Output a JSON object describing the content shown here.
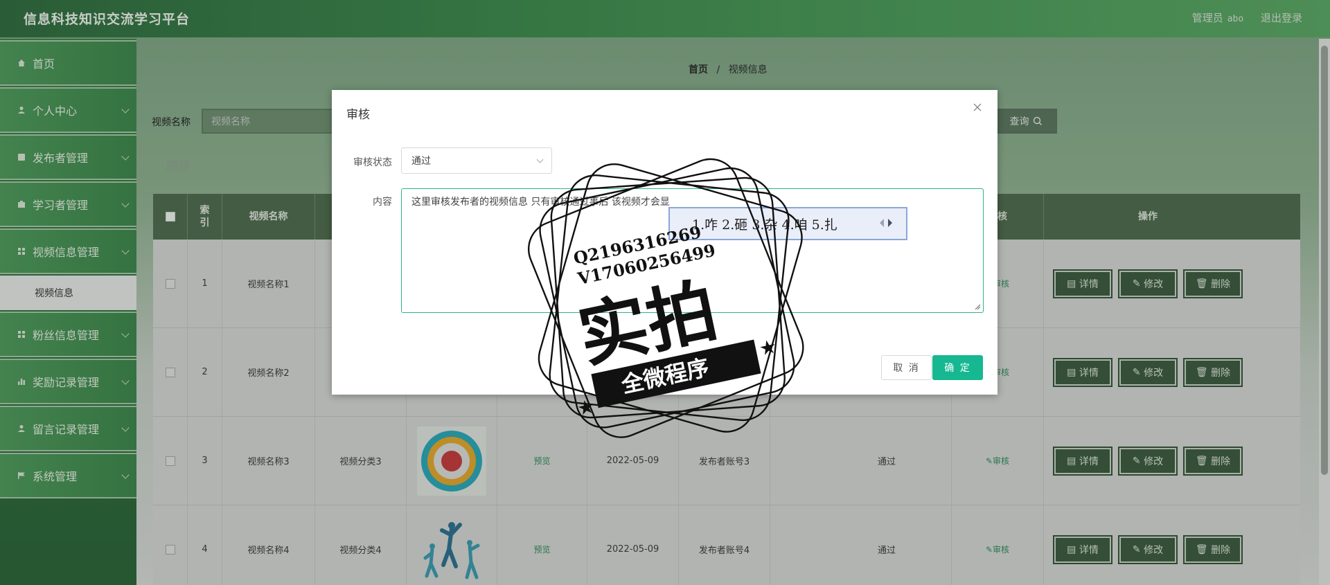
{
  "header": {
    "app_title": "信息科技知识交流学习平台",
    "role": "管理员",
    "username": "abo",
    "logout": "退出登录"
  },
  "sidebar": {
    "items": [
      {
        "label": "首页",
        "icon": "home-icon"
      },
      {
        "label": "个人中心",
        "icon": "person-icon"
      },
      {
        "label": "发布者管理",
        "icon": "book-icon"
      },
      {
        "label": "学习者管理",
        "icon": "briefcase-icon"
      },
      {
        "label": "视频信息管理",
        "icon": "grid-icon"
      },
      {
        "label": "视频信息",
        "icon": ""
      },
      {
        "label": "粉丝信息管理",
        "icon": "grid-icon"
      },
      {
        "label": "奖励记录管理",
        "icon": "bar-chart-icon"
      },
      {
        "label": "留言记录管理",
        "icon": "person-icon"
      },
      {
        "label": "系统管理",
        "icon": "flag-icon"
      }
    ]
  },
  "breadcrumb": {
    "home": "首页",
    "sep": "/",
    "current": "视频信息"
  },
  "search": {
    "label": "视频名称",
    "placeholder": "视频名称",
    "query_button": "查询"
  },
  "toolbar": {
    "delete": "删除"
  },
  "table": {
    "headers": [
      "",
      "索引",
      "视频名称",
      "",
      "",
      "",
      "",
      "",
      "",
      "审核",
      "操作"
    ],
    "rows": [
      {
        "index": "1",
        "name": "视频名称1",
        "category": "",
        "preview": "",
        "date": "",
        "publisher": "",
        "status": "",
        "audit": "审核"
      },
      {
        "index": "2",
        "name": "视频名称2",
        "category": "",
        "preview": "",
        "date": "",
        "publisher": "",
        "status": "",
        "audit": "审核"
      },
      {
        "index": "3",
        "name": "视频名称3",
        "category": "视频分类3",
        "preview": "预览",
        "date": "2022-05-09",
        "publisher": "发布者账号3",
        "status": "通过",
        "audit": "审核"
      },
      {
        "index": "4",
        "name": "视频名称4",
        "category": "视频分类4",
        "preview": "预览",
        "date": "2022-05-09",
        "publisher": "发布者账号4",
        "status": "通过",
        "audit": "审核"
      }
    ],
    "actions": {
      "detail": "详情",
      "edit": "修改",
      "delete": "删除"
    }
  },
  "modal": {
    "title": "审核",
    "status_label": "审核状态",
    "status_value": "通过",
    "content_label": "内容",
    "content_value": "这里审核发布者的视频信息 只有审核通过事后 该视频才会显",
    "cancel": "取 消",
    "ok": "确 定"
  },
  "ime": {
    "candidates": "1.咋 2.砸 3.杂 4.咱 5.扎"
  },
  "watermark": {
    "line1": "Q2196316269",
    "line2": "V17060256499",
    "big": "实拍",
    "ribbon": "全微程序"
  },
  "colors": {
    "accent": "#17b891",
    "header_green": "#3d8a4e",
    "table_head": "#4f6b4e"
  }
}
